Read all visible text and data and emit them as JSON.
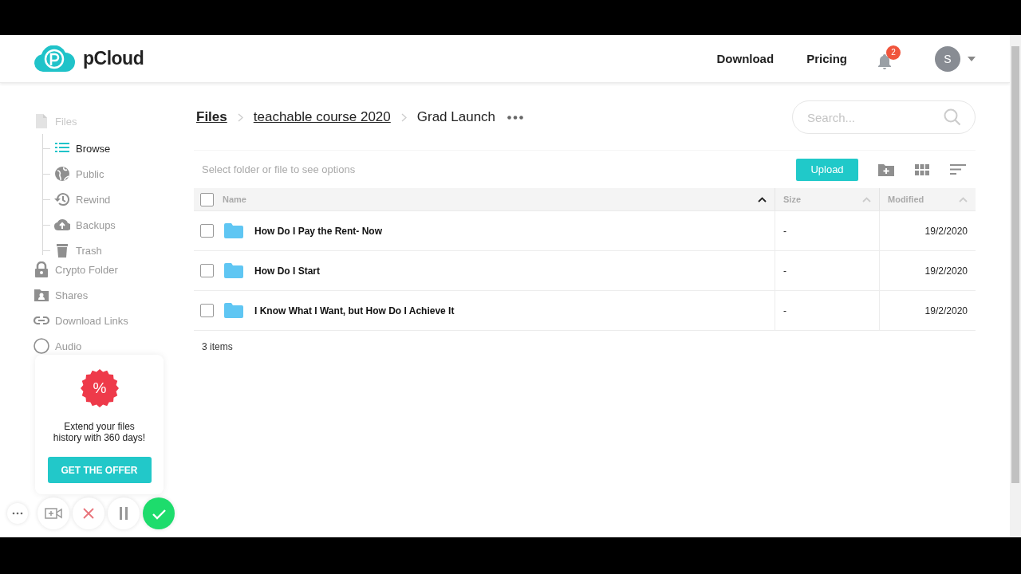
{
  "header": {
    "logo_text": "pCloud",
    "nav": [
      "Download",
      "Pricing"
    ],
    "notifications": {
      "count": "2"
    },
    "avatar": {
      "initial": "S"
    }
  },
  "sidebar": {
    "items": [
      {
        "label": "Files",
        "kind": "group",
        "selected": false,
        "children": [
          {
            "label": "Browse",
            "selected": true
          },
          {
            "label": "Public",
            "selected": false
          },
          {
            "label": "Rewind",
            "selected": false
          },
          {
            "label": "Backups",
            "selected": false
          },
          {
            "label": "Trash",
            "selected": false
          }
        ]
      },
      {
        "label": "Crypto Folder",
        "kind": "item",
        "selected": false
      },
      {
        "label": "Shares",
        "kind": "item",
        "selected": false
      },
      {
        "label": "Download Links",
        "kind": "item",
        "selected": false
      },
      {
        "label": "Audio",
        "kind": "item",
        "selected": false
      }
    ]
  },
  "promo": {
    "badge": "%",
    "text": "Extend your files history with 360 days!",
    "button": "GET THE OFFER"
  },
  "recorder": {
    "buttons": [
      {
        "kind": "more"
      },
      {
        "kind": "camera"
      },
      {
        "kind": "cancel"
      },
      {
        "kind": "pause"
      },
      {
        "kind": "done"
      }
    ]
  },
  "breadcrumb": [
    {
      "label": "Files",
      "kind": "root"
    },
    {
      "label": "teachable course 2020",
      "kind": "link"
    },
    {
      "label": "Grad Launch",
      "kind": "current"
    }
  ],
  "search": {
    "placeholder": "Search..."
  },
  "toolbar": {
    "hint": "Select folder or file to see options",
    "upload": "Upload"
  },
  "table": {
    "select_all": {
      "checked": false
    },
    "columns": [
      {
        "label": "Name",
        "sorted": true
      },
      {
        "label": "Size",
        "sorted": false
      },
      {
        "label": "Modified",
        "sorted": false
      }
    ],
    "rows": [
      {
        "name": "How Do I Pay the Rent- Now",
        "size": "-",
        "modified": "19/2/2020",
        "checked": false
      },
      {
        "name": "How Do I Start",
        "size": "-",
        "modified": "19/2/2020",
        "checked": false
      },
      {
        "name": "I Know What I Want, but How Do I Achieve It",
        "size": "-",
        "modified": "19/2/2020",
        "checked": false
      }
    ]
  },
  "status": "3 items"
}
